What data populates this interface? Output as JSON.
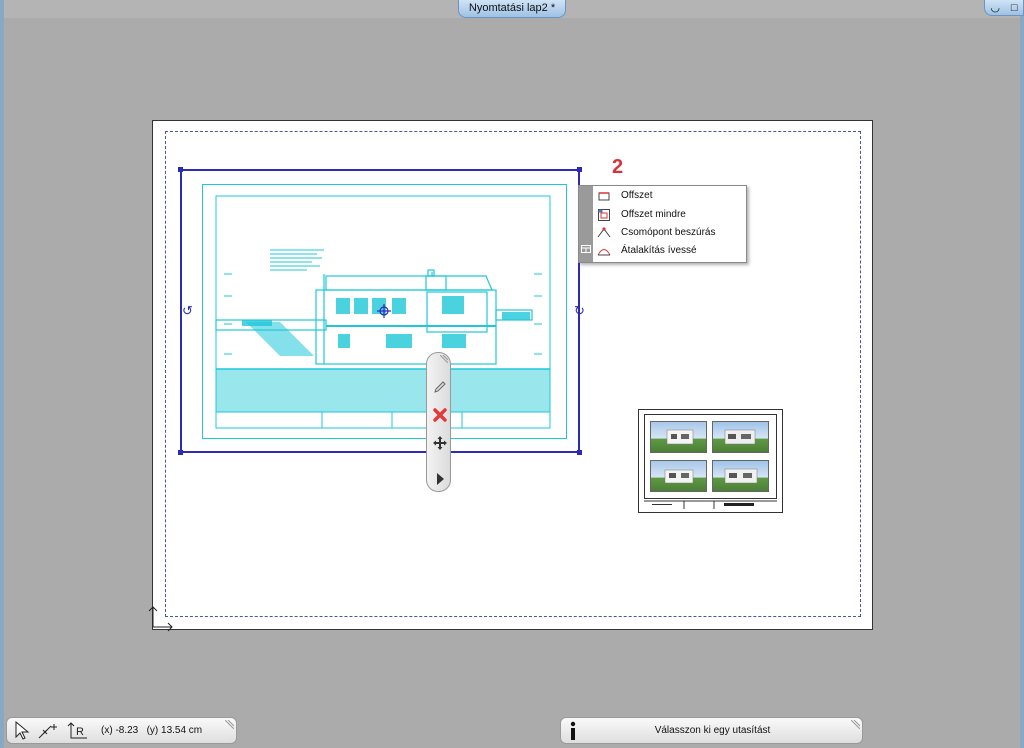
{
  "window": {
    "title": "Nyomtatási lap2 *",
    "controls": {
      "restore": "◡",
      "maximize": "□",
      "close": "✕"
    }
  },
  "context_menu": {
    "step_number": "2",
    "items": [
      {
        "label": "Offszet",
        "icon": "offset-icon"
      },
      {
        "label": "Offszet mindre",
        "icon": "offset-all-icon"
      },
      {
        "label": "Csomópont beszúrás",
        "icon": "insert-node-icon"
      },
      {
        "label": "Átalakítás ívessé",
        "icon": "convert-to-arc-icon"
      }
    ]
  },
  "tool_palette": {
    "buttons": [
      {
        "name": "edit-pencil-icon"
      },
      {
        "name": "delete-x-icon"
      },
      {
        "name": "move-icon"
      },
      {
        "name": "expand-arrow-icon"
      }
    ]
  },
  "status_bar": {
    "coords": "(x) -8.23   (y) 13.54 cm",
    "hint": "Válasszon ki egy utasítást",
    "icons": [
      "cursor-arrow-icon",
      "snap-point-icon",
      "relative-coords-icon",
      "info-icon"
    ]
  },
  "colors": {
    "background": "#ababab",
    "selection": "#2b2bb8",
    "drawing": "#1fc7d8",
    "step_number": "#d8333a",
    "print_margin": "#4455aa"
  }
}
